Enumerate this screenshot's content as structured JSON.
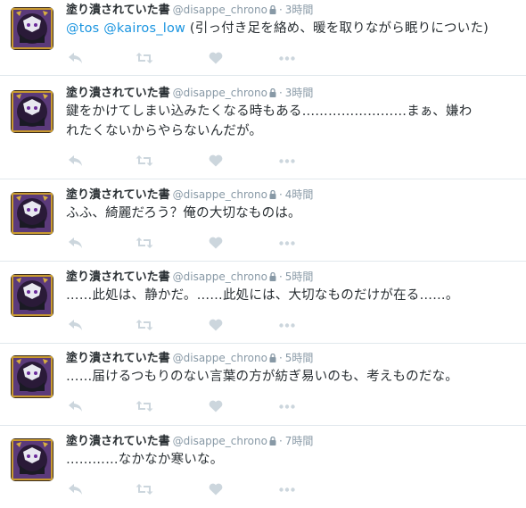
{
  "tweets": [
    {
      "display_name": "塗り潰されていた書",
      "handle": "@disappe_chrono",
      "time": "3時間",
      "mentions": [
        "@tos",
        "@kairos_low"
      ],
      "text_after_mentions": "(引っ付き足を絡め、暖を取りながら眠りについた)"
    },
    {
      "display_name": "塗り潰されていた書",
      "handle": "@disappe_chrono",
      "time": "3時間",
      "text_line1": "鍵をかけてしまい込みたくなる時もある……………………まぁ、嫌わ",
      "text_line2": "れたくないからやらないんだが。"
    },
    {
      "display_name": "塗り潰されていた書",
      "handle": "@disappe_chrono",
      "time": "4時間",
      "text_line1": "ふふ、綺麗だろう？俺の大切なものは。"
    },
    {
      "display_name": "塗り潰されていた書",
      "handle": "@disappe_chrono",
      "time": "5時間",
      "text_line1": "……此処は、静かだ。……此処には、大切なものだけが在る……。"
    },
    {
      "display_name": "塗り潰されていた書",
      "handle": "@disappe_chrono",
      "time": "5時間",
      "text_line1": "……届けるつもりのない言葉の方が紡ぎ易いのも、考えものだな。"
    },
    {
      "display_name": "塗り潰されていた書",
      "handle": "@disappe_chrono",
      "time": "7時間",
      "text_line1": "…………なかなか寒いな。"
    }
  ],
  "meta_separator": "·",
  "icons": {
    "avatar": "character-avatar",
    "protected": "lock-icon",
    "reply": "reply-icon",
    "retweet": "retweet-icon",
    "like": "heart-icon",
    "more": "more-icon"
  },
  "colors": {
    "name": "#292f33",
    "meta": "#8899a6",
    "mention": "#1b95e0",
    "action_icon": "#ccd6dd",
    "divider": "#e1e8ed"
  }
}
